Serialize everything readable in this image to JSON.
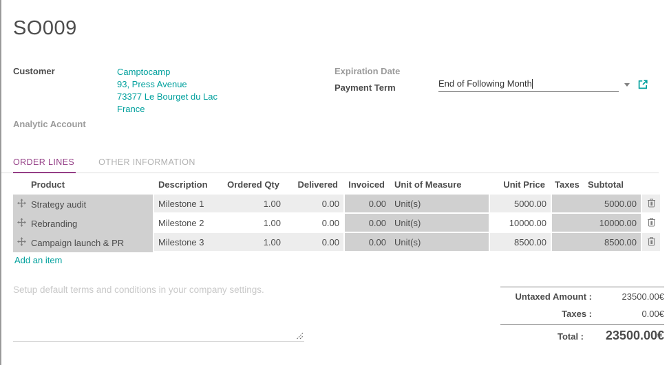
{
  "page": {
    "title": "SO009"
  },
  "fields": {
    "customer": {
      "label": "Customer",
      "name": "Camptocamp",
      "address_line1": "93, Press Avenue",
      "address_line2": "73377 Le Bourget du Lac",
      "address_line3": "France"
    },
    "analytic_account": {
      "label": "Analytic Account"
    },
    "expiration_date": {
      "label": "Expiration Date"
    },
    "payment_term": {
      "label": "Payment Term",
      "value": "End of Following Month"
    }
  },
  "tabs": {
    "order_lines": "ORDER LINES",
    "other_information": "OTHER INFORMATION"
  },
  "table": {
    "headers": {
      "product": "Product",
      "description": "Description",
      "ordered_qty": "Ordered Qty",
      "delivered": "Delivered",
      "invoiced": "Invoiced",
      "uom": "Unit of Measure",
      "unit_price": "Unit Price",
      "taxes": "Taxes",
      "subtotal": "Subtotal"
    },
    "rows": [
      {
        "product": "Strategy audit",
        "description": "Milestone 1",
        "ordered_qty": "1.00",
        "delivered": "0.00",
        "invoiced": "0.00",
        "uom": "Unit(s)",
        "unit_price": "5000.00",
        "taxes": "",
        "subtotal": "5000.00"
      },
      {
        "product": "Rebranding",
        "description": "Milestone 2",
        "ordered_qty": "1.00",
        "delivered": "0.00",
        "invoiced": "0.00",
        "uom": "Unit(s)",
        "unit_price": "10000.00",
        "taxes": "",
        "subtotal": "10000.00"
      },
      {
        "product": "Campaign launch & PR",
        "description": "Milestone 3",
        "ordered_qty": "1.00",
        "delivered": "0.00",
        "invoiced": "0.00",
        "uom": "Unit(s)",
        "unit_price": "8500.00",
        "taxes": "",
        "subtotal": "8500.00"
      }
    ],
    "add_item": "Add an item"
  },
  "notes": {
    "placeholder": "Setup default terms and conditions in your company settings."
  },
  "totals": {
    "untaxed": {
      "label": "Untaxed Amount :",
      "value": "23500.00€"
    },
    "taxes": {
      "label": "Taxes :",
      "value": "0.00€"
    },
    "total": {
      "label": "Total :",
      "value": "23500.00€"
    }
  },
  "colors": {
    "accent_teal": "#00a09d",
    "tab_active_purple": "#943e86",
    "readonly_cell_bg": "#d0d0d0",
    "stripe_bg": "#ededed",
    "text_dark": "#4c4c4c",
    "text_muted": "#9b9b9b"
  }
}
